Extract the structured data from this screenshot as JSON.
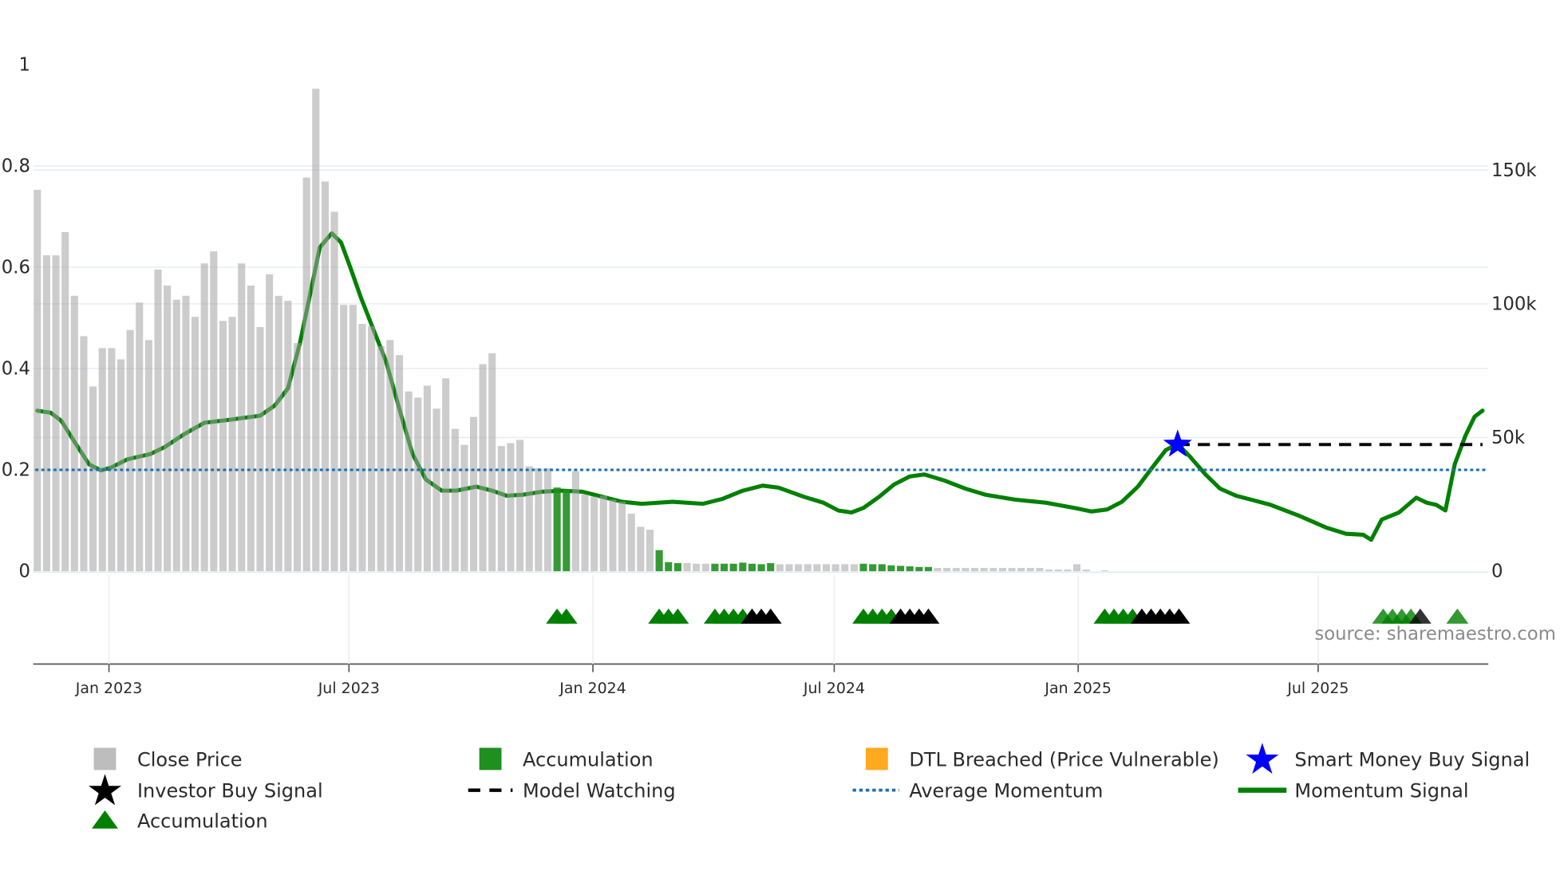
{
  "chart_data": {
    "type": "bar+line",
    "title": "",
    "source_label": "source: sharemaestro.com",
    "left_axis": {
      "range": [
        0,
        1
      ],
      "ticks": [
        "0",
        "0.2",
        "0.4",
        "0.6",
        "0.8",
        "1"
      ],
      "tick_values": [
        0,
        0.2,
        0.4,
        0.6,
        0.8,
        1
      ]
    },
    "right_axis": {
      "range_k": [
        0,
        190
      ],
      "ticks": [
        "0",
        "50k",
        "100k",
        "150k"
      ],
      "tick_values_k": [
        0,
        50,
        100,
        150
      ]
    },
    "x_axis": {
      "ticks": [
        "Jan 2023",
        "Jul 2023",
        "Jan 2024",
        "Jul 2024",
        "Jan 2025",
        "Jul 2025"
      ],
      "tick_dates": [
        "2023-01-01",
        "2023-07-01",
        "2024-01-01",
        "2024-07-01",
        "2025-01-01",
        "2025-07-01"
      ]
    },
    "close_price": {
      "name": "Close Price",
      "axis": "right",
      "first_week": "2022-11-08",
      "interval_days": 7,
      "values_k": [
        142.6,
        118.1,
        118.1,
        126.8,
        103.0,
        87.9,
        69.1,
        83.4,
        83.4,
        79.2,
        90.2,
        100.4,
        86.4,
        112.8,
        106.8,
        101.5,
        103.0,
        95.1,
        115.1,
        119.6,
        93.6,
        95.1,
        115.1,
        106.8,
        91.3,
        111.0,
        103.0,
        101.1,
        85.3,
        147.2,
        180.4,
        145.7,
        134.4,
        99.6,
        99.6,
        92.5,
        91.7,
        84.2,
        86.4,
        80.8,
        67.2,
        64.9,
        69.4,
        60.8,
        72.1,
        53.2,
        47.2,
        57.7,
        77.4,
        81.5,
        46.8,
        47.9,
        49.1,
        39.2,
        38.5,
        38.5,
        31.3,
        30.6,
        37.4,
        28.7,
        27.9,
        28.3,
        26.8,
        26.0,
        21.5,
        16.6,
        15.5,
        7.9,
        3.4,
        3.0,
        3.0,
        2.8,
        2.8,
        2.8,
        2.8,
        2.8,
        3.2,
        2.8,
        2.6,
        3.0,
        2.6,
        2.6,
        2.6,
        2.6,
        2.6,
        2.6,
        2.6,
        2.6,
        2.6,
        2.8,
        2.6,
        2.6,
        2.2,
        2.0,
        1.8,
        1.6,
        1.6,
        1.2,
        1.2,
        1.2,
        1.2,
        1.2,
        1.2,
        1.2,
        1.2,
        1.2,
        1.2,
        1.2,
        1.2,
        0.6,
        0.6,
        0.6,
        2.6,
        0.6,
        0.0,
        0.3
      ],
      "accumulation_weeks": [
        56,
        57,
        67,
        68,
        69,
        73,
        74,
        75,
        76,
        77,
        78,
        79,
        89,
        90,
        91,
        92,
        93,
        94,
        95,
        96
      ]
    },
    "average_momentum": {
      "name": "Average Momentum",
      "value": 0.2
    },
    "momentum_signal": {
      "name": "Momentum Signal",
      "axis": "left",
      "points": [
        [
          "2022-11-08",
          0.317
        ],
        [
          "2022-11-18",
          0.313
        ],
        [
          "2022-11-26",
          0.297
        ],
        [
          "2022-12-07",
          0.251
        ],
        [
          "2022-12-17",
          0.211
        ],
        [
          "2022-12-26",
          0.199
        ],
        [
          "2023-01-03",
          0.205
        ],
        [
          "2023-01-15",
          0.221
        ],
        [
          "2023-02-01",
          0.231
        ],
        [
          "2023-02-12",
          0.245
        ],
        [
          "2023-02-27",
          0.271
        ],
        [
          "2023-03-14",
          0.293
        ],
        [
          "2023-04-02",
          0.299
        ],
        [
          "2023-04-25",
          0.307
        ],
        [
          "2023-05-06",
          0.327
        ],
        [
          "2023-05-16",
          0.361
        ],
        [
          "2023-05-25",
          0.45
        ],
        [
          "2023-06-02",
          0.55
        ],
        [
          "2023-06-09",
          0.639
        ],
        [
          "2023-06-18",
          0.667
        ],
        [
          "2023-06-25",
          0.649
        ],
        [
          "2023-07-02",
          0.6
        ],
        [
          "2023-07-10",
          0.54
        ],
        [
          "2023-07-19",
          0.48
        ],
        [
          "2023-07-29",
          0.414
        ],
        [
          "2023-08-09",
          0.311
        ],
        [
          "2023-08-18",
          0.231
        ],
        [
          "2023-08-28",
          0.181
        ],
        [
          "2023-09-09",
          0.159
        ],
        [
          "2023-09-20",
          0.159
        ],
        [
          "2023-10-05",
          0.167
        ],
        [
          "2023-10-17",
          0.159
        ],
        [
          "2023-10-28",
          0.149
        ],
        [
          "2023-11-09",
          0.151
        ],
        [
          "2023-11-24",
          0.157
        ],
        [
          "2023-12-09",
          0.159
        ],
        [
          "2023-12-24",
          0.157
        ],
        [
          "2024-01-08",
          0.147
        ],
        [
          "2024-01-23",
          0.137
        ],
        [
          "2024-02-07",
          0.133
        ],
        [
          "2024-03-01",
          0.137
        ],
        [
          "2024-03-24",
          0.133
        ],
        [
          "2024-04-08",
          0.143
        ],
        [
          "2024-04-23",
          0.159
        ],
        [
          "2024-05-08",
          0.169
        ],
        [
          "2024-05-20",
          0.165
        ],
        [
          "2024-06-08",
          0.147
        ],
        [
          "2024-06-23",
          0.135
        ],
        [
          "2024-07-04",
          0.12
        ],
        [
          "2024-07-14",
          0.116
        ],
        [
          "2024-07-23",
          0.125
        ],
        [
          "2024-08-04",
          0.147
        ],
        [
          "2024-08-15",
          0.171
        ],
        [
          "2024-08-27",
          0.187
        ],
        [
          "2024-09-07",
          0.191
        ],
        [
          "2024-09-22",
          0.179
        ],
        [
          "2024-10-08",
          0.163
        ],
        [
          "2024-10-23",
          0.151
        ],
        [
          "2024-11-15",
          0.141
        ],
        [
          "2024-12-08",
          0.135
        ],
        [
          "2024-12-31",
          0.124
        ],
        [
          "2025-01-11",
          0.118
        ],
        [
          "2025-01-23",
          0.122
        ],
        [
          "2025-02-03",
          0.137
        ],
        [
          "2025-02-15",
          0.167
        ],
        [
          "2025-02-26",
          0.205
        ],
        [
          "2025-03-08",
          0.239
        ],
        [
          "2025-03-17",
          0.251
        ],
        [
          "2025-03-26",
          0.227
        ],
        [
          "2025-04-07",
          0.191
        ],
        [
          "2025-04-18",
          0.163
        ],
        [
          "2025-04-30",
          0.149
        ],
        [
          "2025-05-26",
          0.131
        ],
        [
          "2025-06-18",
          0.108
        ],
        [
          "2025-07-07",
          0.086
        ],
        [
          "2025-07-22",
          0.074
        ],
        [
          "2025-08-04",
          0.072
        ],
        [
          "2025-08-10",
          0.062
        ],
        [
          "2025-08-18",
          0.102
        ],
        [
          "2025-08-31",
          0.116
        ],
        [
          "2025-09-13",
          0.145
        ],
        [
          "2025-09-21",
          0.135
        ],
        [
          "2025-09-28",
          0.131
        ],
        [
          "2025-10-05",
          0.12
        ],
        [
          "2025-10-12",
          0.211
        ],
        [
          "2025-10-20",
          0.267
        ],
        [
          "2025-10-27",
          0.305
        ],
        [
          "2025-11-02",
          0.317
        ]
      ]
    },
    "smart_money_buy_signal": {
      "name": "Smart Money Buy Signal",
      "date": "2025-03-17",
      "value": 0.25
    },
    "model_watching": {
      "name": "Model Watching",
      "from": "2025-03-17",
      "to": "2025-11-02",
      "value": 0.25
    },
    "signal_markers": {
      "accumulation": [
        "2023-12-05",
        "2023-12-12",
        "2024-02-20",
        "2024-02-27",
        "2024-03-05",
        "2024-04-02",
        "2024-04-09",
        "2024-04-16",
        "2024-04-23",
        "2024-07-23",
        "2024-07-30",
        "2024-08-06",
        "2024-08-13",
        "2025-01-21",
        "2025-01-28",
        "2025-02-04",
        "2025-02-11"
      ],
      "investor_buy": [
        "2024-04-30",
        "2024-05-07",
        "2024-05-14",
        "2024-08-20",
        "2024-08-27",
        "2024-09-03",
        "2024-09-10",
        "2025-02-18",
        "2025-02-25",
        "2025-03-04",
        "2025-03-11",
        "2025-03-18"
      ],
      "accumulation_recent": [
        "2025-08-19",
        "2025-08-26",
        "2025-09-02",
        "2025-09-09",
        "2025-10-14"
      ],
      "investor_buy_recent": [
        "2025-09-16"
      ]
    },
    "legend": {
      "placement": "bottom",
      "items": [
        {
          "label": "Close Price",
          "icon": "gray-square"
        },
        {
          "label": "Accumulation",
          "icon": "green-square"
        },
        {
          "label": "DTL Breached (Price Vulnerable)",
          "icon": "orange-square"
        },
        {
          "label": "Smart Money Buy Signal",
          "icon": "blue-star"
        },
        {
          "label": "Investor Buy Signal",
          "icon": "black-star"
        },
        {
          "label": "Model Watching",
          "icon": "black-dashed-line"
        },
        {
          "label": "Average Momentum",
          "icon": "blue-dotted-line"
        },
        {
          "label": "Momentum Signal",
          "icon": "green-line"
        },
        {
          "label": "Accumulation",
          "icon": "green-triangle"
        }
      ]
    },
    "colors": {
      "close_price": "#a3a3a3",
      "accumulation_bar": "#1f8f1f",
      "dtl": "#ffa91f",
      "smart_money": "#0000ff",
      "investor": "#000000",
      "momentum": "#008000",
      "average_momentum": "#1f6fb4",
      "grid": "#e8edf3"
    }
  }
}
